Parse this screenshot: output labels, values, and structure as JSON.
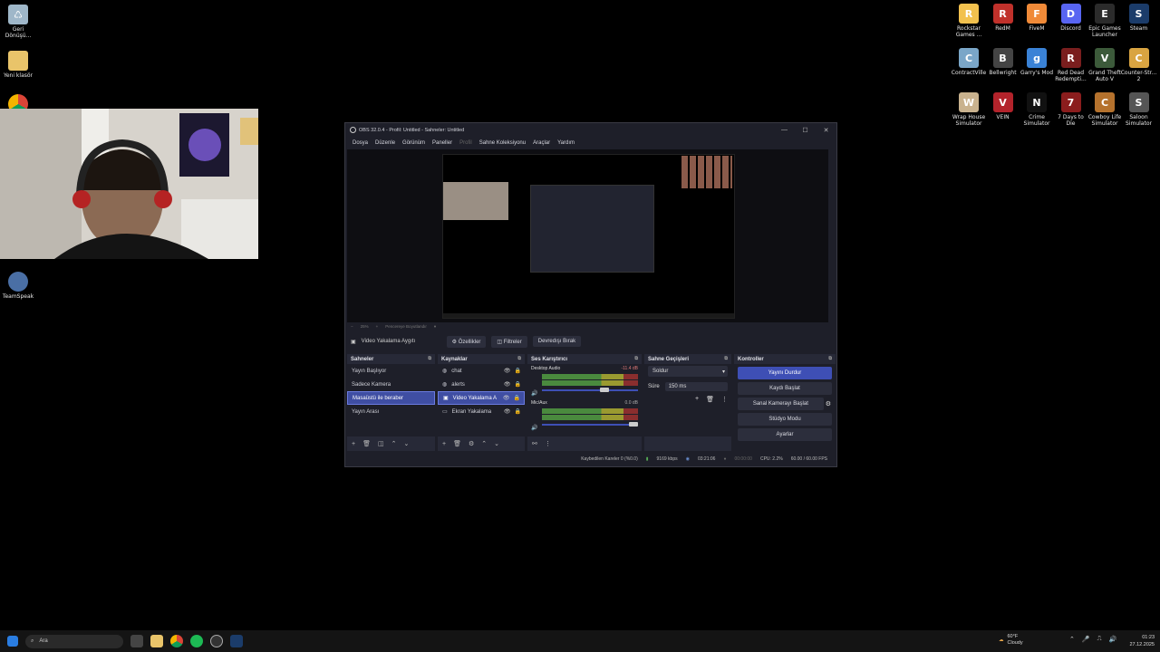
{
  "desktop_left": [
    {
      "label": "Geri Dönüşü...",
      "icon": "recycle-bin-icon",
      "color": "#9fb7c9"
    },
    {
      "label": "Yeni klasör",
      "icon": "folder-icon",
      "color": "#e9c46a"
    },
    {
      "label": "TeamSpeak",
      "icon": "teamspeak-icon",
      "color": "#4a6fa5"
    }
  ],
  "desktop_right": [
    {
      "label": "Rockstar Games ...",
      "icon": "rockstar-icon",
      "color": "#f2c14e",
      "glyph": "R"
    },
    {
      "label": "RedM",
      "icon": "redm-icon",
      "color": "#c0312b",
      "glyph": "R"
    },
    {
      "label": "FiveM",
      "icon": "fivem-icon",
      "color": "#f08a38",
      "glyph": "F"
    },
    {
      "label": "Discord",
      "icon": "discord-icon",
      "color": "#5865f2",
      "glyph": "D"
    },
    {
      "label": "Epic Games Launcher",
      "icon": "epic-games-icon",
      "color": "#2b2b2b",
      "glyph": "E"
    },
    {
      "label": "Steam",
      "icon": "steam-icon",
      "color": "#1b3c6a",
      "glyph": "S"
    },
    {
      "label": "ContractVille",
      "icon": "contractville-icon",
      "color": "#7aa6c8",
      "glyph": "C"
    },
    {
      "label": "Bellwright",
      "icon": "bellwright-icon",
      "color": "#444",
      "glyph": "B"
    },
    {
      "label": "Garry's Mod",
      "icon": "garrys-mod-icon",
      "color": "#3a82d6",
      "glyph": "g"
    },
    {
      "label": "Red Dead Redempti...",
      "icon": "rdr-icon",
      "color": "#7a1e1e",
      "glyph": "R"
    },
    {
      "label": "Grand Theft Auto V",
      "icon": "gta-icon",
      "color": "#3c5a3a",
      "glyph": "V"
    },
    {
      "label": "Counter-Str... 2",
      "icon": "cs2-icon",
      "color": "#d9a441",
      "glyph": "C"
    },
    {
      "label": "Wrap House Simulator",
      "icon": "wrap-house-icon",
      "color": "#c9b28e",
      "glyph": "W"
    },
    {
      "label": "VEIN",
      "icon": "vein-icon",
      "color": "#b3232b",
      "glyph": "V"
    },
    {
      "label": "Crime Simulator",
      "icon": "crime-sim-icon",
      "color": "#111",
      "glyph": "N"
    },
    {
      "label": "7 Days to Die",
      "icon": "7days-icon",
      "color": "#8b1d1d",
      "glyph": "7"
    },
    {
      "label": "Cowboy Life Simulator",
      "icon": "cowboy-icon",
      "color": "#b5722d",
      "glyph": "C"
    },
    {
      "label": "Saloon Simulator",
      "icon": "saloon-icon",
      "color": "#555",
      "glyph": "S"
    }
  ],
  "obs": {
    "title": "OBS 32.0.4 - Profil: Untitled - Sahneler: Untitled",
    "menu": [
      "Dosya",
      "Düzenle",
      "Görünüm",
      "Paneller",
      "Profil",
      "Sahne Koleksiyonu",
      "Araçlar",
      "Yardım"
    ],
    "zoom": "25%",
    "zoom_mode": "Pencereye Boyutlandır",
    "source_name": "Video Yakalama Aygıtı",
    "btn_props": "Özellikler",
    "btn_filters": "Filtreler",
    "btn_deactivate": "Devredışı Bırak",
    "scenes_title": "Sahneler",
    "scenes": [
      "Yayın Başlıyor",
      "Sadece Kamera",
      "Masaüstü ile beraber",
      "Yayın Arası"
    ],
    "sources_title": "Kaynaklar",
    "sources": [
      "chat",
      "alerts",
      "Video Yakalama A",
      "Ekran Yakalama"
    ],
    "mixer_title": "Ses Karıştırıcı",
    "mixer": [
      {
        "name": "Desktop Audio",
        "db": "-11.4 dB",
        "level": 0.8
      },
      {
        "name": "Mic/Aux",
        "db": "0.0 dB",
        "level": 1.0
      }
    ],
    "trans_title": "Sahne Geçişleri",
    "trans_type": "Soldur",
    "duration_label": "Süre",
    "duration": "150 ms",
    "controls_title": "Kontroller",
    "controls": [
      "Yayını Durdur",
      "Kaydı Başlat",
      "Sanal Kamerayı Başlat",
      "Stüdyo Modu",
      "Ayarlar"
    ],
    "status": {
      "dropped": "Kaybedilen Kareler 0 (%0.0)",
      "bitrate": "9169 kbps",
      "stream_time": "03:21:06",
      "rec_time": "00:00:00",
      "cpu": "CPU: 2.2%",
      "fps": "60.00 / 60.00 FPS"
    }
  },
  "taskbar": {
    "search_placeholder": "Ara",
    "weather": "60°F",
    "weather_desc": "Cloudy",
    "time": "01:23",
    "date": "27.12.2025"
  }
}
